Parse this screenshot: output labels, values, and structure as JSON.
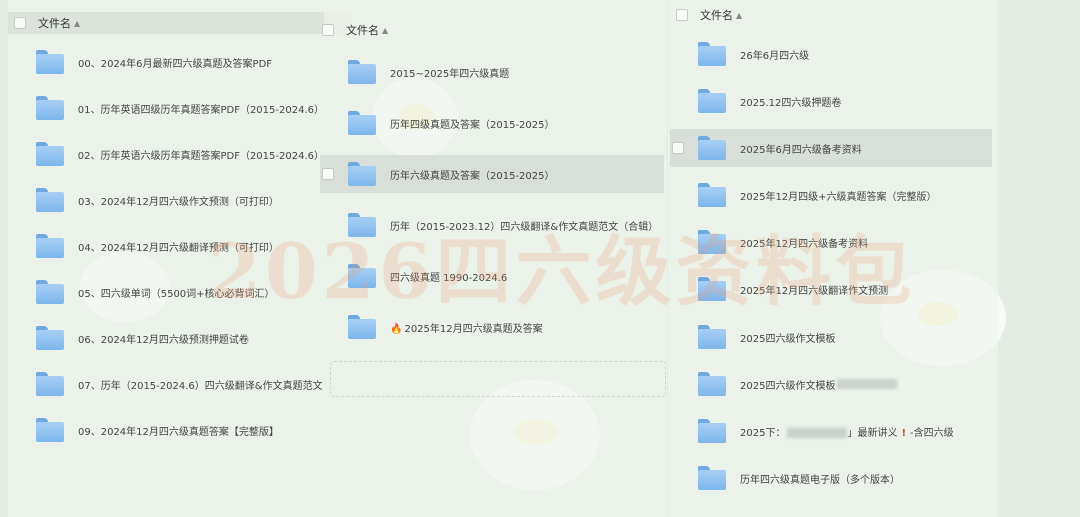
{
  "header": {
    "col_label": "文件名",
    "sort_icon": "sort-icon"
  },
  "watermark": "2026四六级资料包",
  "panel1": {
    "items": [
      {
        "label": "00、2024年6月最新四六级真题及答案PDF"
      },
      {
        "label": "01、历年英语四级历年真题答案PDF（2015-2024.6）"
      },
      {
        "label": "02、历年英语六级历年真题答案PDF（2015-2024.6）"
      },
      {
        "label": "03、2024年12月四六级作文预测（可打印）"
      },
      {
        "label": "04、2024年12月四六级翻译预测（可打印）"
      },
      {
        "label": "05、四六级单词（5500词+核心必背词汇）"
      },
      {
        "label": "06、2024年12月四六级预测押题试卷"
      },
      {
        "label": "07、历年（2015-2024.6）四六级翻译&作文真题范文"
      },
      {
        "label": "09、2024年12月四六级真题答案【完整版】"
      }
    ]
  },
  "panel2": {
    "items": [
      {
        "label": "2015~2025年四六级真题"
      },
      {
        "label": "历年四级真题及答案（2015-2025）"
      },
      {
        "label": "历年六级真题及答案（2015-2025）"
      },
      {
        "label": "历年（2015-2023.12）四六级翻译&作文真题范文（合辑）"
      },
      {
        "label": "四六级真题 1990-2024.6"
      },
      {
        "label": "2025年12月四六级真题及答案"
      }
    ]
  },
  "panel3": {
    "items": [
      {
        "label": "26年6月四六级"
      },
      {
        "label": "2025.12四六级押题卷"
      },
      {
        "label": "2025年6月四六级备考资料"
      },
      {
        "label": "2025年12月四级+六级真题答案（完整版）"
      },
      {
        "label": "2025年12月四六级备考资料"
      },
      {
        "label": "2025年12月四六级翻译作文预测"
      },
      {
        "label": "2025四六级作文模板"
      },
      {
        "label": "2025四六级作文模板"
      },
      {
        "label_a": "2025下：",
        "label_b": "」最新讲义",
        "label_c": "-含四六级"
      },
      {
        "label": "历年四六级真题电子版（多个版本）"
      }
    ]
  }
}
